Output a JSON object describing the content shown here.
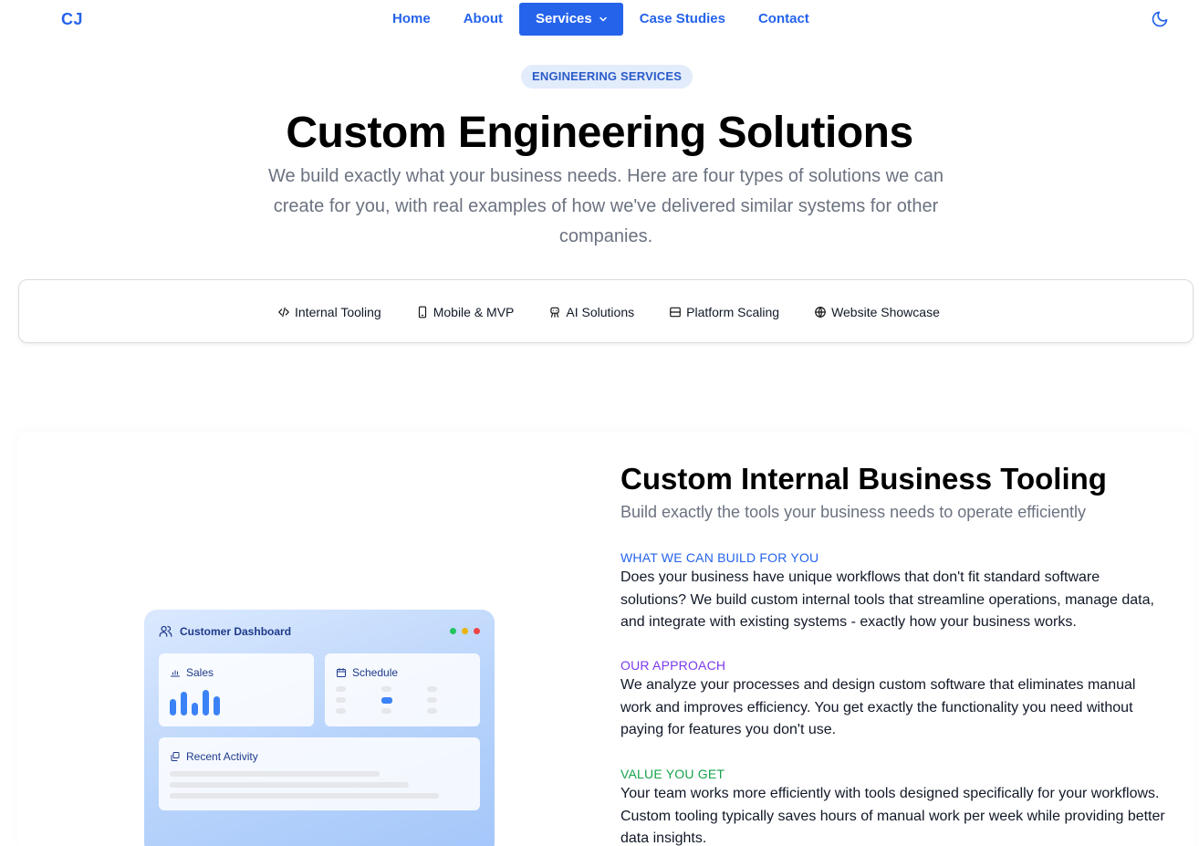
{
  "header": {
    "logo": "CJ",
    "nav": [
      {
        "label": "Home",
        "active": false
      },
      {
        "label": "About",
        "active": false
      },
      {
        "label": "Services",
        "active": true
      },
      {
        "label": "Case Studies",
        "active": false
      },
      {
        "label": "Contact",
        "active": false
      }
    ],
    "theme_icon": "moon-icon"
  },
  "hero": {
    "badge": "ENGINEERING SERVICES",
    "title": "Custom Engineering Solutions",
    "subtitle": "We build exactly what your business needs. Here are four types of solutions we can create for you, with real examples of how we've delivered similar systems for other companies."
  },
  "tabs": [
    {
      "label": "Internal Tooling",
      "icon": "code-icon"
    },
    {
      "label": "Mobile & MVP",
      "icon": "smartphone-icon"
    },
    {
      "label": "AI Solutions",
      "icon": "bot-icon"
    },
    {
      "label": "Platform Scaling",
      "icon": "server-icon"
    },
    {
      "label": "Website Showcase",
      "icon": "globe-icon"
    }
  ],
  "feature": {
    "title": "Custom Internal Business Tooling",
    "subtitle": "Build exactly the tools your business needs to operate efficiently",
    "sections": [
      {
        "label": "WHAT WE CAN BUILD FOR YOU",
        "color": "#2563eb",
        "body": "Does your business have unique workflows that don't fit standard software solutions? We build custom internal tools that streamline operations, manage data, and integrate with existing systems - exactly how your business works."
      },
      {
        "label": "OUR APPROACH",
        "color": "#7c3aed",
        "body": "We analyze your processes and design custom software that eliminates manual work and improves efficiency. You get exactly the functionality you need without paying for features you don't use."
      },
      {
        "label": "VALUE YOU GET",
        "color": "#16a34a",
        "body": "Your team works more efficiently with tools designed specifically for your workflows. Custom tooling typically saves hours of manual work per week while providing better data insights."
      }
    ]
  },
  "dashboard": {
    "title": "Customer Dashboard",
    "sales": "Sales",
    "schedule": "Schedule",
    "recent_activity": "Recent Activity",
    "dot_colors": [
      "#22c55e",
      "#eab308",
      "#ef4444"
    ]
  },
  "colors": {
    "accent": "#2563eb",
    "purple": "#7c3aed",
    "green": "#16a34a"
  }
}
